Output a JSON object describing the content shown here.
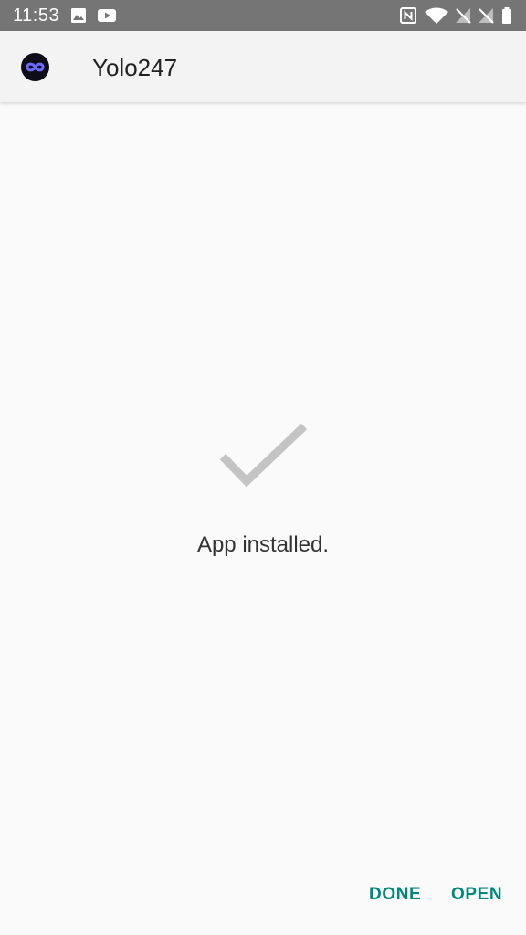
{
  "status_bar": {
    "time": "11:53",
    "left_icons": [
      "image-icon",
      "youtube-icon"
    ],
    "right_icons": [
      "nfc-icon",
      "wifi-icon",
      "no-signal-icon",
      "no-signal-icon",
      "battery-icon"
    ],
    "background_color": "#757575"
  },
  "app_bar": {
    "icon": "infinity-icon",
    "title": "Yolo247"
  },
  "main": {
    "icon": "checkmark-icon",
    "message": "App installed."
  },
  "actions": {
    "done_label": "DONE",
    "open_label": "OPEN",
    "accent_color": "#00897b"
  }
}
